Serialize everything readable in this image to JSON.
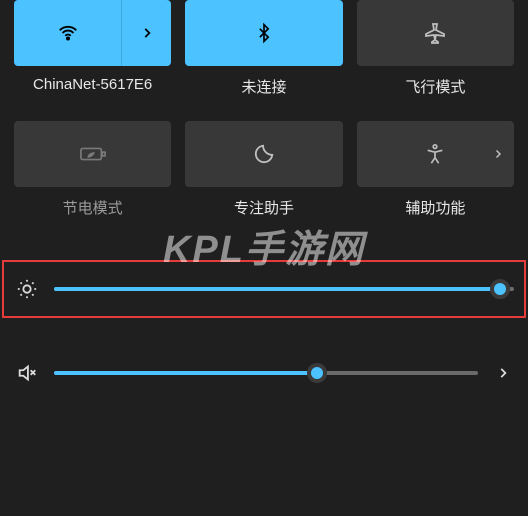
{
  "tiles": {
    "wifi": {
      "label": "ChinaNet-5617E6",
      "active": true
    },
    "bluetooth": {
      "label": "未连接",
      "active": true
    },
    "airplane": {
      "label": "飞行模式",
      "active": false
    },
    "battery": {
      "label": "节电模式",
      "active": false
    },
    "focus": {
      "label": "专注助手",
      "active": false
    },
    "access": {
      "label": "辅助功能",
      "active": false
    }
  },
  "sliders": {
    "brightness": {
      "value": 97
    },
    "volume": {
      "value": 62
    }
  },
  "watermark": "KPL手游网"
}
